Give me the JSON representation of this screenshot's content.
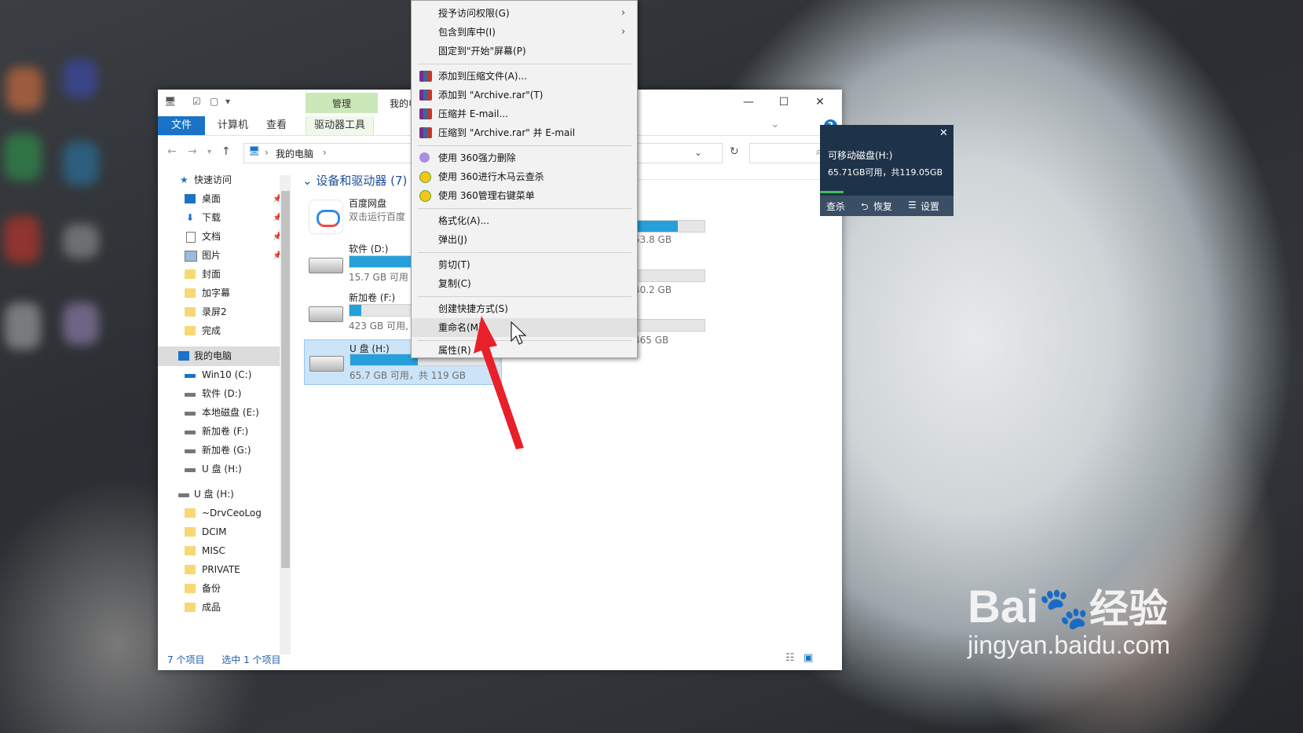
{
  "explorer": {
    "title_tab": "管理",
    "title_text": "我的电",
    "ribbon_tabs": [
      "文件",
      "计算机",
      "查看",
      "驱动器工具"
    ],
    "help": "?",
    "address": {
      "path": "我的电脑"
    },
    "sidebar": {
      "items": [
        {
          "label": "快速访问"
        },
        {
          "label": "桌面"
        },
        {
          "label": "下载"
        },
        {
          "label": "文档"
        },
        {
          "label": "图片"
        },
        {
          "label": "封面"
        },
        {
          "label": "加字幕"
        },
        {
          "label": "录屏2"
        },
        {
          "label": "完成"
        },
        {
          "label": "我的电脑"
        },
        {
          "label": "Win10 (C:)"
        },
        {
          "label": "软件 (D:)"
        },
        {
          "label": "本地磁盘 (E:)"
        },
        {
          "label": "新加卷 (F:)"
        },
        {
          "label": "新加卷 (G:)"
        },
        {
          "label": "U 盘 (H:)"
        },
        {
          "label": "U 盘 (H:)"
        },
        {
          "label": "~DrvCeoLog"
        },
        {
          "label": "DCIM"
        },
        {
          "label": "MISC"
        },
        {
          "label": "PRIVATE"
        },
        {
          "label": "备份"
        },
        {
          "label": "成品"
        }
      ]
    },
    "group_header": "设备和驱动器 (7)",
    "tiles": [
      {
        "name": "百度网盘",
        "sub": "双击运行百度"
      },
      {
        "name": "软件 (D:)",
        "free": "15.7 GB 可用",
        "fill": 0.85
      },
      {
        "name": "新加卷 (F:)",
        "free": "423 GB 可用,",
        "fill": 0.08
      },
      {
        "name": "U 盘 (H:)",
        "free": "65.7 GB 可用，共 119 GB",
        "fill": 0.45
      }
    ],
    "right_column": [
      {
        "text": "53.8 GB",
        "fill": 0.62
      },
      {
        "text": "40.2 GB",
        "fill": 0
      },
      {
        "text": "465 GB",
        "fill": 0
      }
    ],
    "status": {
      "count": "7 个项目",
      "selected": "选中 1 个项目"
    }
  },
  "context_menu": {
    "items": [
      {
        "label": "授予访问权限(G)",
        "submenu": true
      },
      {
        "label": "包含到库中(I)",
        "submenu": true
      },
      {
        "label": "固定到\"开始\"屏幕(P)"
      },
      {
        "label": "添加到压缩文件(A)...",
        "icon": "winrar-icon"
      },
      {
        "label": "添加到 \"Archive.rar\"(T)",
        "icon": "winrar-icon"
      },
      {
        "label": "压缩并 E-mail...",
        "icon": "winrar-icon"
      },
      {
        "label": "压缩到 \"Archive.rar\" 并 E-mail",
        "icon": "winrar-icon"
      },
      {
        "label": "使用 360强力删除",
        "icon": "360-shred-icon"
      },
      {
        "label": "使用 360进行木马云查杀",
        "icon": "360-icon"
      },
      {
        "label": "使用 360管理右键菜单",
        "icon": "360-icon"
      },
      {
        "label": "格式化(A)..."
      },
      {
        "label": "弹出(J)"
      },
      {
        "label": "剪切(T)"
      },
      {
        "label": "复制(C)"
      },
      {
        "label": "创建快捷方式(S)"
      },
      {
        "label": "重命名(M)",
        "highlighted": true
      },
      {
        "label": "属性(R)"
      }
    ]
  },
  "notification": {
    "title": "可移动磁盘(H:)",
    "detail": "65.71GB可用，共119.05GB",
    "buttons": [
      "查杀",
      "恢复",
      "设置"
    ]
  },
  "watermark": {
    "brand": "Bai",
    "brand2": "经验",
    "url": "jingyan.baidu.com"
  },
  "colors": {
    "accent": "#1a73c6",
    "bar": "#26a0da",
    "arrow": "#e8202a"
  }
}
